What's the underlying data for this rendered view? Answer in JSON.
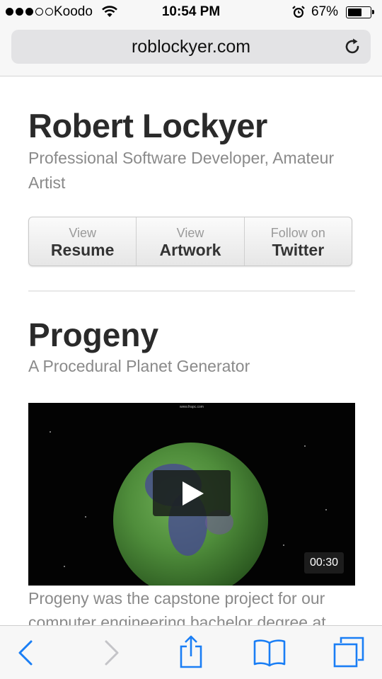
{
  "status_bar": {
    "carrier": "Koodo",
    "time": "10:54 PM",
    "battery_percent": "67%",
    "battery_level": 0.67,
    "signal_bars_filled": 3,
    "signal_bars_total": 5
  },
  "browser": {
    "url": "roblockyer.com",
    "reload_icon": "reload-icon"
  },
  "header": {
    "name": "Robert Lockyer",
    "tagline": "Professional Software Developer, Amateur Artist"
  },
  "buttons": [
    {
      "small": "View",
      "big": "Resume"
    },
    {
      "small": "View",
      "big": "Artwork"
    },
    {
      "small": "Follow on",
      "big": "Twitter"
    }
  ],
  "project": {
    "title": "Progeny",
    "subtitle": "A Procedural Planet Generator",
    "video_header": "www.frapc.com",
    "video_duration": "00:30",
    "description": "Progeny was the capstone project for our computer engineering bachelor degree at"
  },
  "toolbar": {
    "icons": [
      "back-icon",
      "forward-icon",
      "share-icon",
      "bookmarks-icon",
      "tabs-icon"
    ]
  },
  "colors": {
    "link_blue": "#1a7ef5",
    "disabled_gray": "#c4c4c8",
    "text_dark": "#2a2a2a",
    "text_muted": "#8a8a8a"
  }
}
